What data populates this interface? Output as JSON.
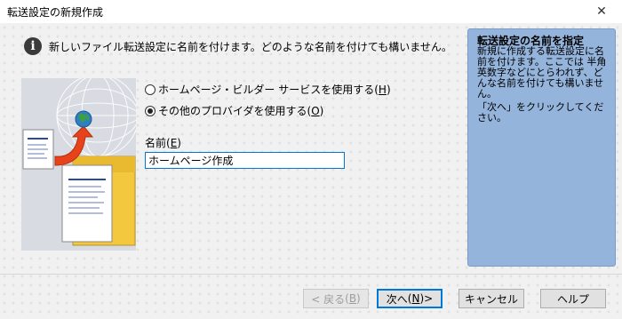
{
  "window": {
    "title": "転送設定の新規作成",
    "close_glyph": "✕"
  },
  "info": {
    "text": "新しいファイル転送設定に名前を付けます。どのような名前を付けても構いません。",
    "icon": "info-icon"
  },
  "options": [
    {
      "label": "ホームページ・ビルダー サービスを使用する",
      "key": "H",
      "checked": false
    },
    {
      "label": "その他のプロバイダを使用する",
      "key": "O",
      "checked": true
    }
  ],
  "name_field": {
    "label": "名前",
    "key": "E",
    "value": "ホームページ作成"
  },
  "help": {
    "title": "転送設定の名前を指定",
    "body": "新規に作成する転送設定に名前を付けます。ここでは 半角英数字などにとらわれず、どんな名前を付けても構いません。",
    "hint": "「次へ」をクリックしてください。"
  },
  "buttons": {
    "back": {
      "label": "< 戻る",
      "key": "B",
      "enabled": false
    },
    "next": {
      "label": "次へ",
      "key": "N",
      "suffix": " >"
    },
    "cancel": {
      "label": "キャンセル"
    },
    "help": {
      "label": "ヘルプ"
    }
  },
  "colors": {
    "help_panel": "#94b4dc",
    "focus_border": "#0078d7",
    "arrow": "#e8421b",
    "folder": "#f3c73e"
  }
}
